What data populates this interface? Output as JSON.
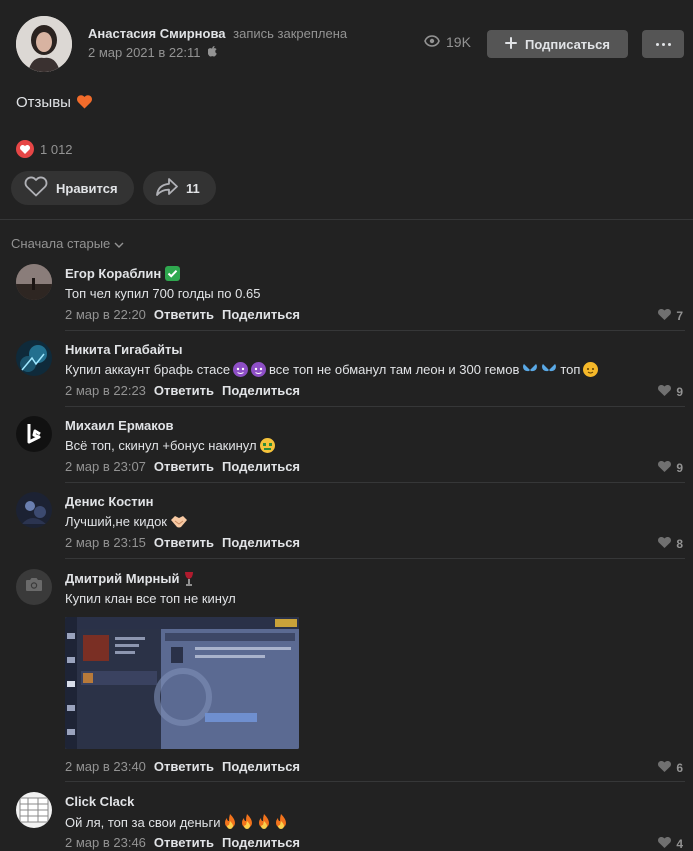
{
  "post": {
    "author": "Анастасия Смирнова",
    "pinned_label": "запись закреплена",
    "date": "2 мар 2021 в 22:11",
    "views": "19K",
    "subscribe_label": "Подписаться",
    "text": "Отзывы",
    "reactions_count": "1 012",
    "like_label": "Нравится",
    "share_count": "11"
  },
  "sort_label": "Сначала старые",
  "comments": [
    {
      "name": "Егор Кораблин",
      "text": "Топ чел купил 700 голды по 0.65",
      "date": "2 мар в 22:20",
      "reply": "Ответить",
      "share": "Поделиться",
      "likes": "7"
    },
    {
      "name": "Никита Гигабайты",
      "text_start": "Купил аккаунт брафь стасе",
      "text_mid": "все топ не обманул там леон и 300 гемов",
      "text_end": "топ",
      "date": "2 мар в 22:23",
      "reply": "Ответить",
      "share": "Поделиться",
      "likes": "9"
    },
    {
      "name": "Михаил Ермаков",
      "text": "Всё топ, скинул +бонус накинул",
      "date": "2 мар в 23:07",
      "reply": "Ответить",
      "share": "Поделиться",
      "likes": "9"
    },
    {
      "name": "Денис Костин",
      "text": "Лучший,не кидок",
      "date": "2 мар в 23:15",
      "reply": "Ответить",
      "share": "Поделиться",
      "likes": "8"
    },
    {
      "name": "Дмитрий Мирный",
      "text": "Купил клан все топ не кинул",
      "date": "2 мар в 23:40",
      "reply": "Ответить",
      "share": "Поделиться",
      "likes": "6"
    },
    {
      "name": "Click Clack",
      "text": "Ой ля, топ за свои деньги",
      "date": "2 мар в 23:46",
      "reply": "Ответить",
      "share": "Поделиться",
      "likes": "4"
    }
  ],
  "attachment": {
    "tabs": [
      "КЛАН",
      "ИНФОРМАЦИЯ",
      "ТОП КЛАНОВ",
      "ЗАПРОСЫ"
    ],
    "subtabs": [
      "ОБЗОР",
      "СОСТАВ",
      "ИСТОРИЯ"
    ],
    "button_label": "ВЫЙТИ",
    "member_label": "УЧАСТНИКИ"
  },
  "colors": {
    "background": "#222222",
    "button": "#555555",
    "accent_red": "#e64646"
  }
}
